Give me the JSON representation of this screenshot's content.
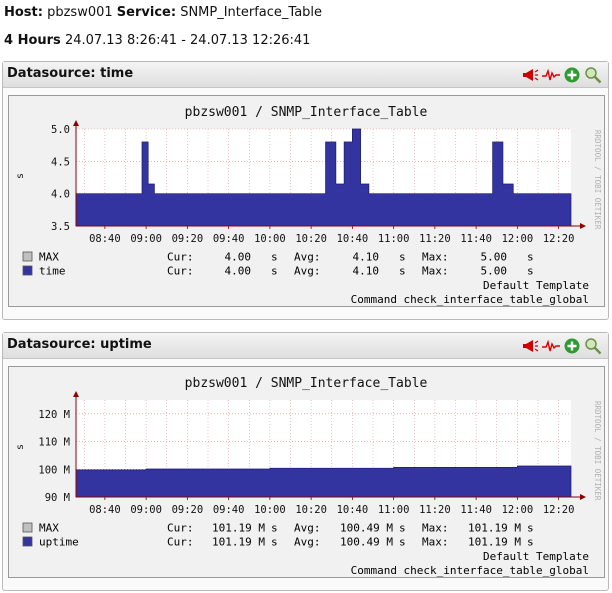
{
  "header": {
    "host_label": "Host:",
    "host_value": "pbzsw001",
    "service_label": "Service:",
    "service_value": "SNMP_Interface_Table",
    "range_label": "4 Hours",
    "range_value": "24.07.13 8:26:41 - 24.07.13 12:26:41"
  },
  "icons": [
    "megaphone-icon",
    "heartbeat-icon",
    "add-icon",
    "zoom-icon"
  ],
  "colors": {
    "area": "#3434a0",
    "area_edge": "#1b1b6b",
    "grid": "#e08a8a",
    "axis": "#8b0000"
  },
  "panels": [
    {
      "title": "Datasource: time",
      "graph_title": "pbzsw001 / SNMP_Interface_Table",
      "y_unit": "s",
      "watermark": "RRDTOOL / TOBI OETIKER",
      "legend": [
        {
          "name": "MAX",
          "cur_label": "Cur:",
          "cur": "4.00",
          "cur_unit": "s",
          "avg_label": "Avg:",
          "avg": "4.10",
          "avg_unit": "s",
          "max_label": "Max:",
          "max": "5.00",
          "max_unit": "s",
          "swatch": "#c0c0c0"
        },
        {
          "name": "time",
          "cur_label": "Cur:",
          "cur": "4.00",
          "cur_unit": "s",
          "avg_label": "Avg:",
          "avg": "4.10",
          "avg_unit": "s",
          "max_label": "Max:",
          "max": "5.00",
          "max_unit": "s",
          "swatch": "#3434a0"
        }
      ],
      "template_line": "Default Template",
      "command_line": "Command check_interface_table_global",
      "chart_data": {
        "type": "area",
        "x_ticks": [
          "08:40",
          "09:00",
          "09:20",
          "09:40",
          "10:00",
          "10:20",
          "10:40",
          "11:00",
          "11:20",
          "11:40",
          "12:00",
          "12:20"
        ],
        "y_ticks": [
          "3.5",
          "4.0",
          "4.5",
          "5.0"
        ],
        "ylim": [
          3.5,
          5.0
        ],
        "series": [
          {
            "name": "time",
            "points": [
              [
                "08:26",
                4.0
              ],
              [
                "08:58",
                4.0
              ],
              [
                "08:58",
                4.8
              ],
              [
                "09:01",
                4.8
              ],
              [
                "09:01",
                4.15
              ],
              [
                "09:04",
                4.15
              ],
              [
                "09:04",
                4.0
              ],
              [
                "10:27",
                4.0
              ],
              [
                "10:27",
                4.8
              ],
              [
                "10:32",
                4.8
              ],
              [
                "10:32",
                4.15
              ],
              [
                "10:36",
                4.15
              ],
              [
                "10:36",
                4.8
              ],
              [
                "10:40",
                4.8
              ],
              [
                "10:40",
                5.0
              ],
              [
                "10:44",
                5.0
              ],
              [
                "10:44",
                4.15
              ],
              [
                "10:48",
                4.15
              ],
              [
                "10:48",
                4.0
              ],
              [
                "11:48",
                4.0
              ],
              [
                "11:48",
                4.8
              ],
              [
                "11:53",
                4.8
              ],
              [
                "11:53",
                4.15
              ],
              [
                "11:58",
                4.15
              ],
              [
                "11:58",
                4.0
              ],
              [
                "12:26",
                4.0
              ]
            ]
          }
        ]
      }
    },
    {
      "title": "Datasource: uptime",
      "graph_title": "pbzsw001 / SNMP_Interface_Table",
      "y_unit": "s",
      "watermark": "RRDTOOL / TOBI OETIKER",
      "legend": [
        {
          "name": "MAX",
          "cur_label": "Cur:",
          "cur": "101.19 M",
          "cur_unit": "s",
          "avg_label": "Avg:",
          "avg": "100.49 M",
          "avg_unit": "s",
          "max_label": "Max:",
          "max": "101.19 M",
          "max_unit": "s",
          "swatch": "#c0c0c0"
        },
        {
          "name": "uptime",
          "cur_label": "Cur:",
          "cur": "101.19 M",
          "cur_unit": "s",
          "avg_label": "Avg:",
          "avg": "100.49 M",
          "avg_unit": "s",
          "max_label": "Max:",
          "max": "101.19 M",
          "max_unit": "s",
          "swatch": "#3434a0"
        }
      ],
      "template_line": "Default Template",
      "command_line": "Command check_interface_table_global",
      "chart_data": {
        "type": "area",
        "x_ticks": [
          "08:40",
          "09:00",
          "09:20",
          "09:40",
          "10:00",
          "10:20",
          "10:40",
          "11:00",
          "11:20",
          "11:40",
          "12:00",
          "12:20"
        ],
        "y_ticks": [
          "90 M",
          "100 M",
          "110 M",
          "120 M"
        ],
        "ylim": [
          90,
          125
        ],
        "series": [
          {
            "name": "uptime",
            "points": [
              [
                "08:26",
                99.8
              ],
              [
                "09:00",
                99.8
              ],
              [
                "09:00",
                100.1
              ],
              [
                "10:00",
                100.1
              ],
              [
                "10:00",
                100.4
              ],
              [
                "11:00",
                100.4
              ],
              [
                "11:00",
                100.7
              ],
              [
                "12:00",
                100.7
              ],
              [
                "12:00",
                101.19
              ],
              [
                "12:26",
                101.19
              ]
            ]
          }
        ]
      }
    }
  ]
}
